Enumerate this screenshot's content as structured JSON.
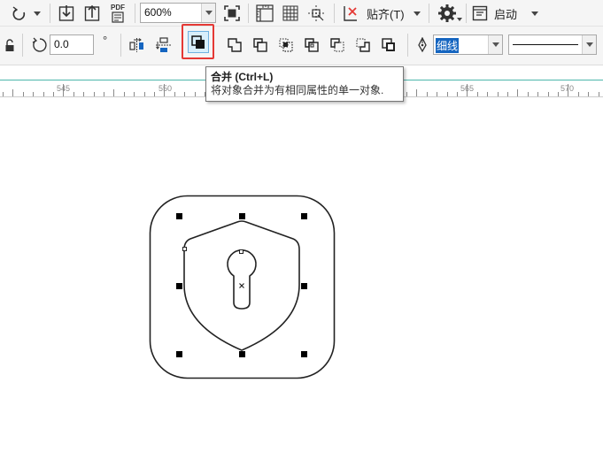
{
  "toolbar_top": {
    "zoom_value": "600%",
    "pdf_label": "PDF",
    "snap_label": "贴齐(T)",
    "launch_label": "启动"
  },
  "toolbar_props": {
    "rotation_value": "0.0",
    "rotation_unit": "°",
    "outline_width_value": "细线"
  },
  "tooltip": {
    "title": "合并 (Ctrl+L)",
    "description": "将对象合并为有相同属性的单一对象."
  },
  "ruler": {
    "labels": [
      "545",
      "550",
      "555",
      "560",
      "565",
      "570"
    ]
  },
  "colors": {
    "highlight_red": "#e53935",
    "ruler_accent": "#4db6ac",
    "selection_blue": "#1565c0"
  }
}
